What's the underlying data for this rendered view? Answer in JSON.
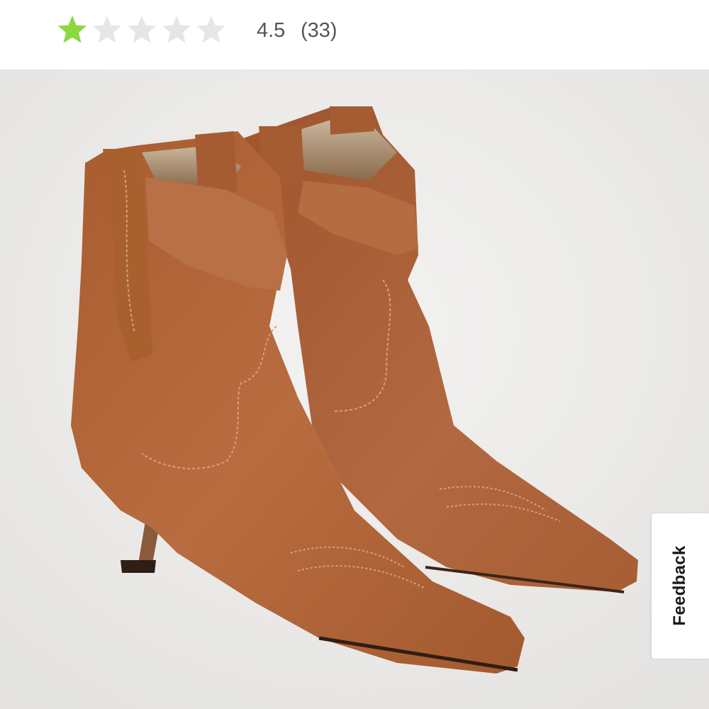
{
  "rating": {
    "value_label": "4.5",
    "count_label": "(33)",
    "score": 4.5,
    "max": 5,
    "star_color": "#8bd83f",
    "empty_star_color": "#e6e6e6",
    "star_icon": "star-icon"
  },
  "product_image": {
    "background_color": "#ecebea",
    "suede_color": "#b0653a"
  },
  "feedback": {
    "label": "Feedback"
  }
}
